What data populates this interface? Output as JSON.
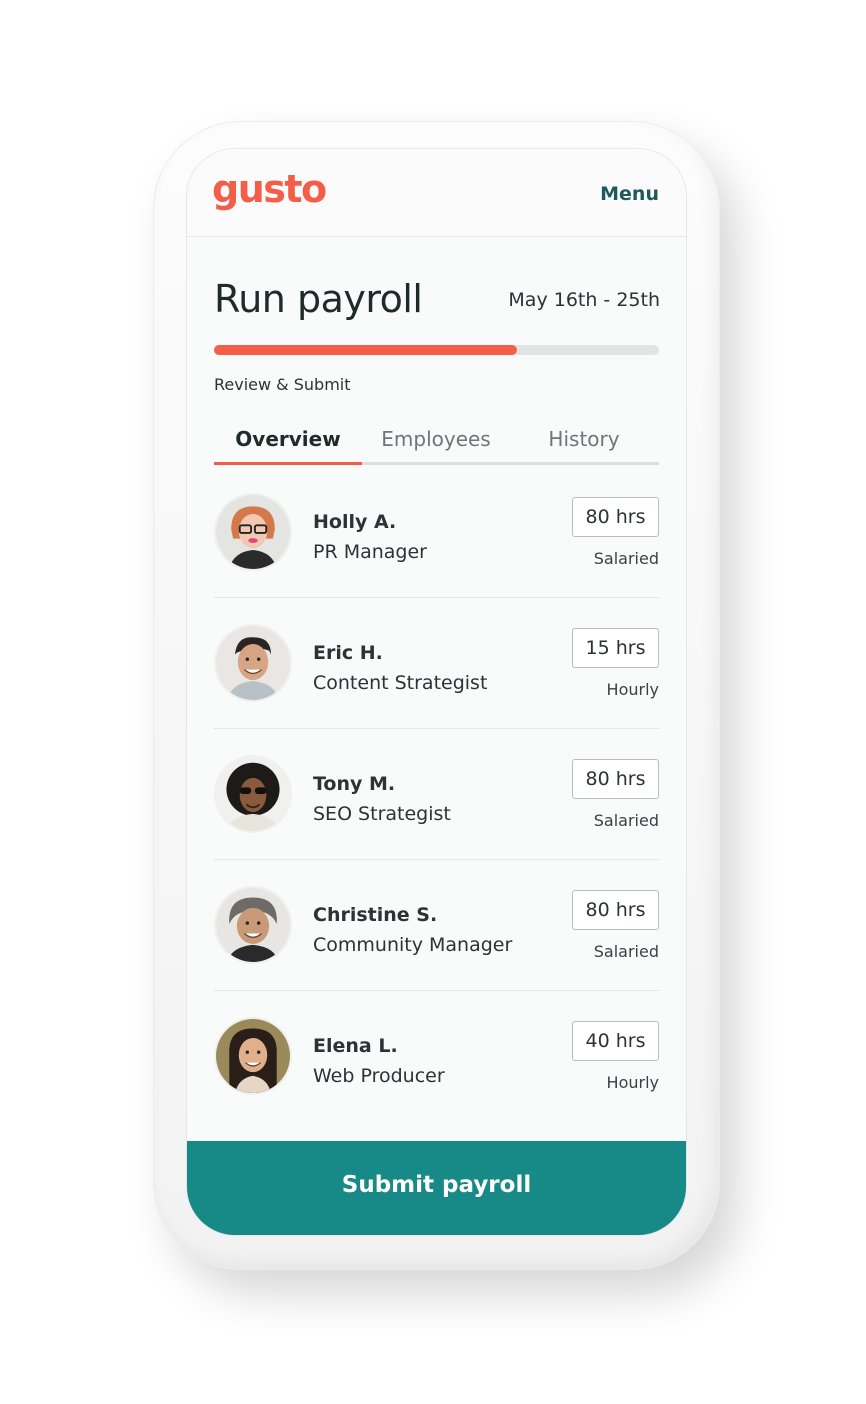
{
  "app": {
    "logo_text": "gusto",
    "menu_label": "Menu",
    "brand_color": "#f45d48",
    "accent_color": "#178a87"
  },
  "page": {
    "title": "Run payroll",
    "period": "May 16th - 25th"
  },
  "progress": {
    "fraction": 0.68,
    "label": "Review & Submit"
  },
  "tabs": [
    {
      "label": "Overview",
      "active": true
    },
    {
      "label": "Employees",
      "active": false
    },
    {
      "label": "History",
      "active": false
    }
  ],
  "employees": [
    {
      "name": "Holly A.",
      "role": "PR Manager",
      "hours": "80 hrs",
      "pay_type": "Salaried"
    },
    {
      "name": "Eric H.",
      "role": "Content Strategist",
      "hours": "15 hrs",
      "pay_type": "Hourly"
    },
    {
      "name": "Tony M.",
      "role": "SEO Strategist",
      "hours": "80 hrs",
      "pay_type": "Salaried"
    },
    {
      "name": "Christine S.",
      "role": "Community Manager",
      "hours": "80 hrs",
      "pay_type": "Salaried"
    },
    {
      "name": "Elena L.",
      "role": "Web Producer",
      "hours": "40 hrs",
      "pay_type": "Hourly"
    }
  ],
  "submit": {
    "label": "Submit payroll"
  }
}
